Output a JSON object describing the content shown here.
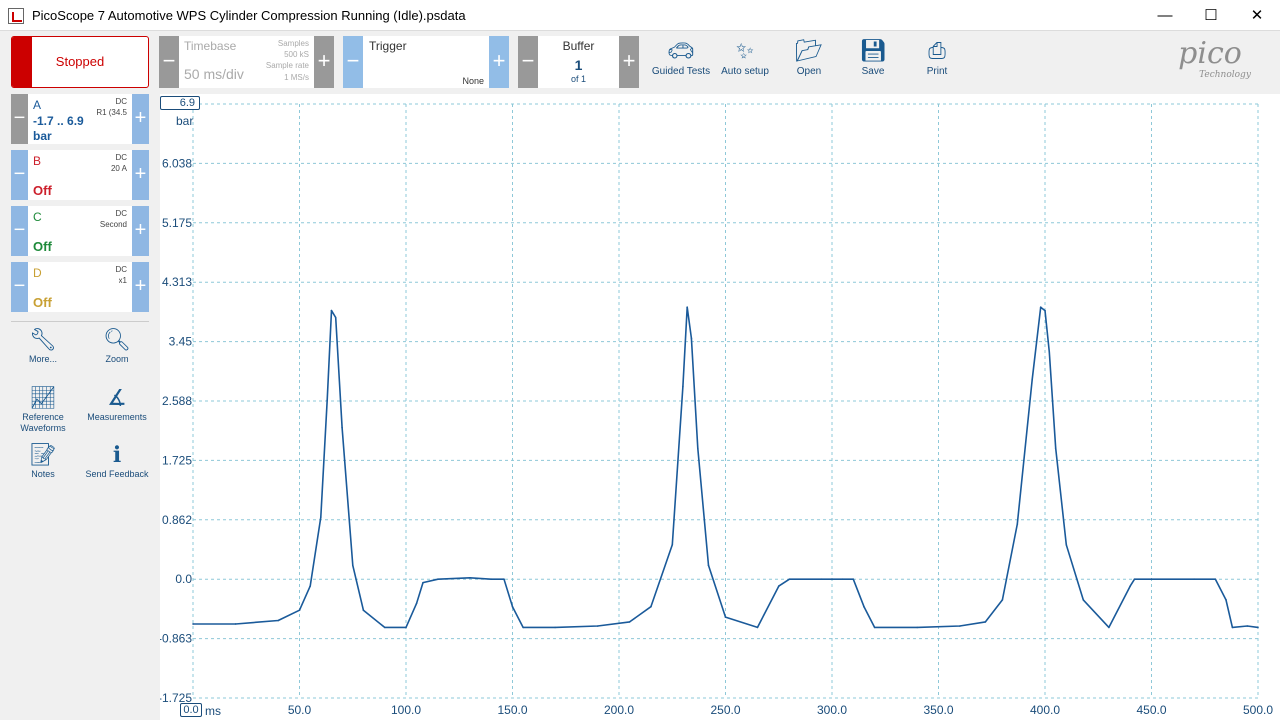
{
  "window": {
    "title": "PicoScope 7 Automotive WPS Cylinder Compression Running (Idle).psdata",
    "minimize": "—",
    "maximize": "☐",
    "close": "✕"
  },
  "toolbar": {
    "run_state": "Stopped",
    "timebase": {
      "label": "Timebase",
      "value": "50 ms/div",
      "samples_label": "Samples",
      "samples": "500 kS",
      "rate_label": "Sample rate",
      "rate": "1 MS/s"
    },
    "trigger": {
      "label": "Trigger",
      "value": "None"
    },
    "buffer": {
      "label": "Buffer",
      "value": "1",
      "of": "of 1"
    },
    "buttons": [
      {
        "label": "Guided Tests",
        "icon": "car-icon"
      },
      {
        "label": "Auto setup",
        "icon": "wand-icon"
      },
      {
        "label": "Open",
        "icon": "folder-icon"
      },
      {
        "label": "Save",
        "icon": "save-icon"
      },
      {
        "label": "Print",
        "icon": "printer-icon"
      }
    ],
    "logo": {
      "brand": "pico",
      "sub": "Technology"
    }
  },
  "channels": [
    {
      "name": "A",
      "coupling": "DC",
      "probe": "R1 (34.5",
      "range": "-1.7 .. 6.9",
      "unit": "bar",
      "color": "#1a5a9a"
    },
    {
      "name": "B",
      "coupling": "DC",
      "probe": "20 A",
      "range": "Off",
      "unit": "",
      "color": "#cc1f2b"
    },
    {
      "name": "C",
      "coupling": "DC",
      "probe": "Second",
      "range": "Off",
      "unit": "",
      "color": "#1e8a3a"
    },
    {
      "name": "D",
      "coupling": "DC",
      "probe": "x1",
      "range": "Off",
      "unit": "",
      "color": "#c8a034"
    }
  ],
  "side_tools": [
    {
      "label": "More...",
      "icon": "wrench-icon"
    },
    {
      "label": "Zoom",
      "icon": "zoom-icon"
    },
    {
      "label": "Reference Waveforms",
      "icon": "reference-waveform-icon"
    },
    {
      "label": "Measurements",
      "icon": "measurements-icon"
    },
    {
      "label": "Notes",
      "icon": "notes-icon"
    },
    {
      "label": "Send Feedback",
      "icon": "feedback-icon"
    }
  ],
  "plot": {
    "y_top": "6.9",
    "y_unit": "bar",
    "y_ticks": [
      "6.038",
      "5.175",
      "4.313",
      "3.45",
      "2.588",
      "1.725",
      "0.862",
      "0.0",
      "-0.863",
      "-1.725"
    ],
    "x_ticks": [
      "0.0",
      "50.0",
      "100.0",
      "150.0",
      "200.0",
      "250.0",
      "300.0",
      "350.0",
      "400.0",
      "450.0",
      "500.0"
    ],
    "x_unit": "ms",
    "trace_color": "#1a5a9a"
  },
  "chart_data": {
    "type": "line",
    "x": [
      0,
      20,
      40,
      50,
      55,
      60,
      63,
      65,
      67,
      70,
      75,
      80,
      90,
      100,
      105,
      108,
      115,
      130,
      140,
      146,
      150,
      155,
      170,
      190,
      205,
      215,
      225,
      230,
      232,
      234,
      237,
      242,
      250,
      265,
      275,
      280,
      295,
      305,
      310,
      315,
      320,
      340,
      360,
      372,
      380,
      387,
      394,
      398,
      400,
      402,
      405,
      410,
      418,
      430,
      440,
      442,
      450,
      470,
      480,
      485,
      488,
      495,
      500
    ],
    "y": [
      -0.65,
      -0.65,
      -0.6,
      -0.45,
      -0.1,
      0.9,
      2.6,
      3.9,
      3.8,
      2.2,
      0.2,
      -0.45,
      -0.7,
      -0.7,
      -0.35,
      -0.05,
      0.0,
      0.02,
      0.0,
      0.0,
      -0.4,
      -0.7,
      -0.7,
      -0.68,
      -0.62,
      -0.4,
      0.5,
      2.8,
      3.95,
      3.5,
      1.9,
      0.2,
      -0.55,
      -0.7,
      -0.1,
      0.0,
      0.0,
      0.0,
      0.0,
      -0.4,
      -0.7,
      -0.7,
      -0.68,
      -0.62,
      -0.3,
      0.8,
      2.9,
      3.95,
      3.9,
      3.3,
      1.9,
      0.5,
      -0.3,
      -0.7,
      -0.1,
      0.0,
      0.0,
      0.0,
      0.0,
      -0.3,
      -0.7,
      -0.68,
      -0.7
    ],
    "xlim": [
      0,
      500
    ],
    "ylim": [
      -1.725,
      6.9
    ],
    "xlabel": "ms",
    "ylabel": "bar",
    "grid": true
  }
}
